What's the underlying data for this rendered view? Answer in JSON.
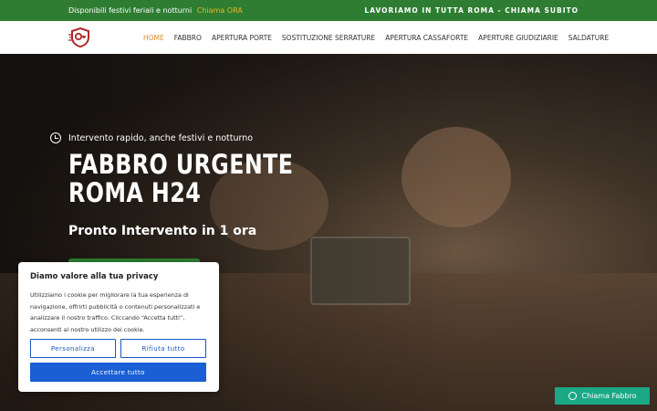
{
  "topbar": {
    "left_text": "Disponibili festivi feriali e notturni",
    "left_accent": "Chiama ORA",
    "right_text": "LAVORIAMO IN TUTTA ROMA - CHIAMA SUBITO",
    "bg_color": "#2e7d32",
    "accent_color": "#f0b323"
  },
  "nav": {
    "logo_icon": "key-shield-icon",
    "items": [
      {
        "label": "HOME",
        "active": true
      },
      {
        "label": "FABBRO",
        "active": false
      },
      {
        "label": "APERTURA PORTE",
        "active": false
      },
      {
        "label": "SOSTITUZIONE SERRATURE",
        "active": false
      },
      {
        "label": "APERTURA CASSAFORTE",
        "active": false
      },
      {
        "label": "APERTURE GIUDIZIARIE",
        "active": false
      },
      {
        "label": "SALDATURE",
        "active": false
      }
    ],
    "active_color": "#e38b29"
  },
  "hero": {
    "tagline": "Intervento rapido, anche festivi e notturno",
    "tagline_icon": "clock-icon",
    "headline_line1": "FABBRO URGENTE",
    "headline_line2": "ROMA H24",
    "subhead": "Pronto Intervento in 1 ora"
  },
  "cookie": {
    "title": "Diamo valore alla tua privacy",
    "body": "Utilizziamo i cookie per migliorare la tua esperienza di navigazione, offrirti pubblicità o contenuti personalizzati e analizzare il nostro traffico. Cliccando “Accetta tutti”, acconsenti al nostro utilizzo dei cookie.",
    "customize_label": "Personalizza",
    "reject_label": "Rifiuta tutto",
    "accept_label": "Accettare tutto",
    "button_color": "#1a5fd4"
  },
  "whatsapp": {
    "label": "Chiama Fabbro",
    "icon": "whatsapp-icon",
    "bg_color": "#1aa886"
  }
}
